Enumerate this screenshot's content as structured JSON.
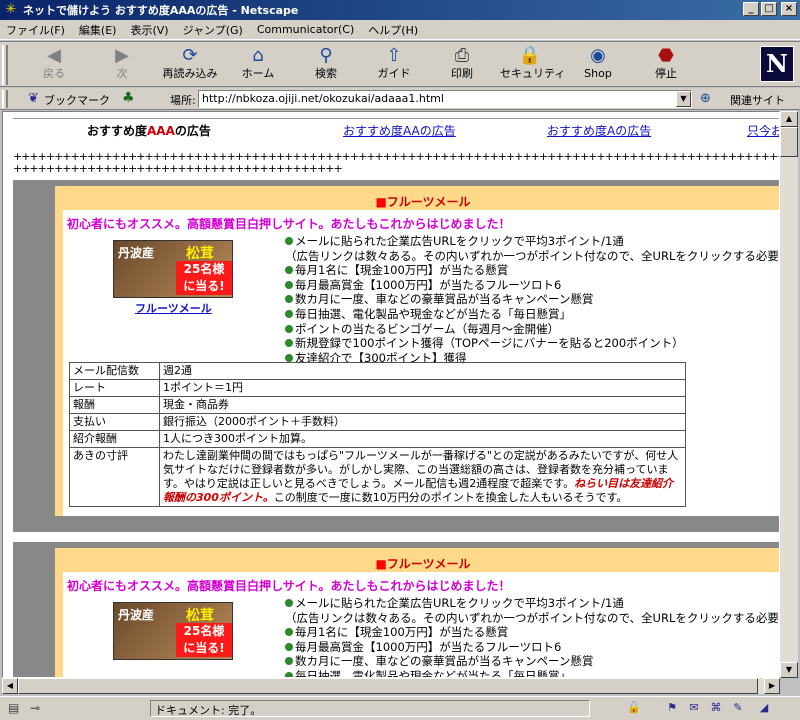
{
  "window": {
    "title": "ネットで儲けよう おすすめ度AAAの広告 - Netscape",
    "buttons": [
      "_",
      "□",
      "×"
    ]
  },
  "menu": [
    "ファイル(F)",
    "編集(E)",
    "表示(V)",
    "ジャンプ(G)",
    "Communicator(C)",
    "ヘルプ(H)"
  ],
  "toolbar": [
    {
      "label": "戻る",
      "icon": "back-arrow-icon",
      "disabled": true
    },
    {
      "label": "次",
      "icon": "forward-arrow-icon",
      "disabled": true
    },
    {
      "label": "再読み込み",
      "icon": "reload-icon",
      "disabled": false
    },
    {
      "label": "ホーム",
      "icon": "home-icon",
      "disabled": false
    },
    {
      "label": "検索",
      "icon": "search-icon",
      "disabled": false
    },
    {
      "label": "ガイド",
      "icon": "guide-icon",
      "disabled": false
    },
    {
      "label": "印刷",
      "icon": "print-icon",
      "disabled": false
    },
    {
      "label": "セキュリティ",
      "icon": "security-lock-icon",
      "disabled": false
    },
    {
      "label": "Shop",
      "icon": "shop-icon",
      "disabled": false
    },
    {
      "label": "停止",
      "icon": "stop-icon",
      "disabled": false
    }
  ],
  "location": {
    "bookmark_label": "ブックマーク",
    "location_label": "場所:",
    "url": "http://nbkoza.ojiji.net/okozukai/adaaa1.html",
    "related_label": "関連サイト"
  },
  "nav": {
    "current_prefix": "おすすめ度",
    "current_rating": "AAA",
    "current_suffix": "の広告",
    "links": [
      "おすすめ度AAの広告",
      "おすすめ度Aの広告",
      "只今お試"
    ]
  },
  "separator": "++++++++++++++++++++++++++++++++++++++++++++++++++++++++++++++++++++++++++++++++++++++++++++++++++++++++++++++++++++++++++++++++++++++++",
  "cards": [
    {
      "name": "フルーツメール",
      "tagline": "初心者にもオススメ。高額懸賞目白押しサイト。あたしもこれからはじめました！",
      "banner": {
        "line1": "丹波産",
        "line2": "松茸",
        "line3": "25名様",
        "line4": "に当る!"
      },
      "banner_link": "フルーツメール",
      "features": [
        "メールに貼られた企業広告URLをクリックで平均3ポイント/1通",
        "（広告リンクは数々ある。その内いずれか一つがポイント付なので、全URLをクリックする必要あ",
        "毎月1名に【現金100万円】が当たる懸賞",
        "毎月最高賞金【1000万円】が当たるフルーツロト6",
        "数カ月に一度、車などの豪華賞品が当るキャンペーン懸賞",
        "毎日抽選、電化製品や現金などが当たる「毎日懸賞」",
        "ポイントの当たるビンゴゲーム（毎週月〜金開催）",
        "新規登録で100ポイント獲得（TOPページにバナーを貼ると200ポイント）",
        "友達紹介で【300ポイント】獲得"
      ],
      "table": [
        {
          "k": "メール配信数",
          "v": "週2通"
        },
        {
          "k": "レート",
          "v": "1ポイント＝1円"
        },
        {
          "k": "報酬",
          "v": "現金・商品券"
        },
        {
          "k": "支払い",
          "v": "銀行振込（2000ポイント＋手数料）"
        },
        {
          "k": "紹介報酬",
          "v": "1人につき300ポイント加算。"
        }
      ],
      "comment_label": "あきの寸評",
      "comment_a": "わたし達副業仲間の間ではもっぱら\"フルーツメールが一番稼げる\"との定説があるみたいですが、何せ人気サイトなだけに登録者数が多い。がしかし実際、この当選総額の高さは、登録者数を充分補っています。やはり定説は正しいと見るべきでしょう。メール配信も週2通程度で超楽です。",
      "comment_hl": "ねらい目は友達紹介報酬の300ポイント。",
      "comment_b": "この制度で一度に数10万円分のポイントを換金した人もいるそうです。"
    }
  ],
  "status": {
    "text": "ドキュメント: 完了。"
  }
}
